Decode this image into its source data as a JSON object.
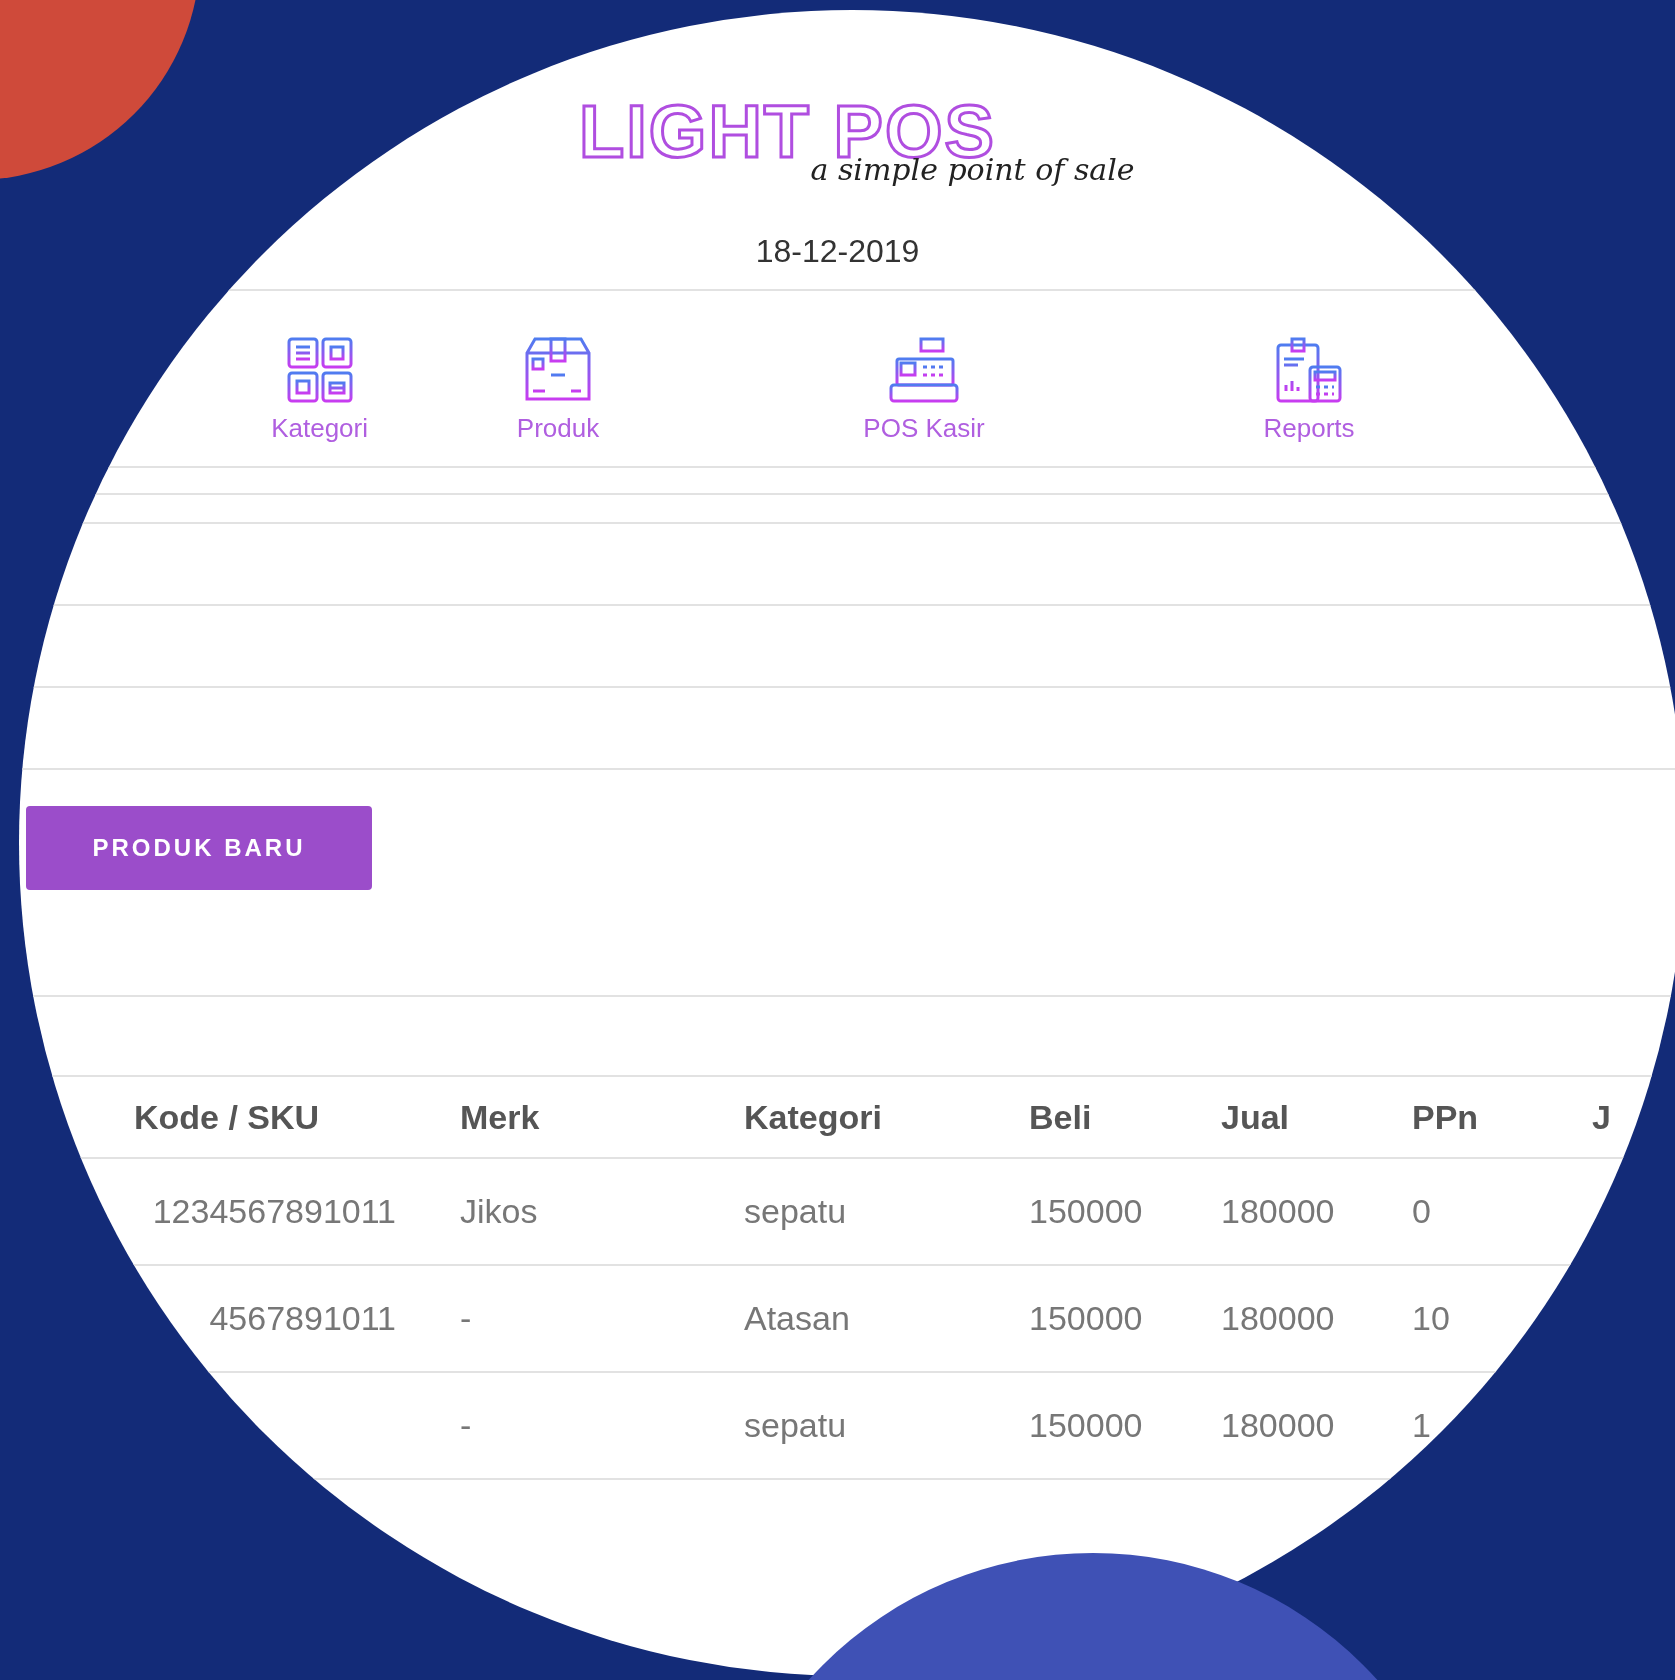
{
  "logo": {
    "title": "LIGHT POS",
    "tagline": "a simple point of sale"
  },
  "date": "18-12-2019",
  "nav": [
    {
      "label": "Kategori",
      "kind": "grid"
    },
    {
      "label": "Produk",
      "kind": "box"
    },
    {
      "label": "POS Kasir",
      "kind": "register"
    },
    {
      "label": "Reports",
      "kind": "report"
    }
  ],
  "new_button": "PRODUK BARU",
  "table": {
    "columns": [
      "Kode / SKU",
      "Merk",
      "Kategori",
      "Beli",
      "Jual",
      "PPn",
      "J"
    ],
    "rows": [
      {
        "sku": "1234567891011",
        "merk": "Jikos",
        "kategori": "sepatu",
        "beli": "150000",
        "jual": "180000",
        "ppn": "0"
      },
      {
        "sku": "4567891011",
        "merk": "-",
        "kategori": "Atasan",
        "beli": "150000",
        "jual": "180000",
        "ppn": "10"
      },
      {
        "merk": "-",
        "kategori": "sepatu",
        "beli": "150000",
        "jual": "180000",
        "ppn": "1"
      }
    ]
  }
}
